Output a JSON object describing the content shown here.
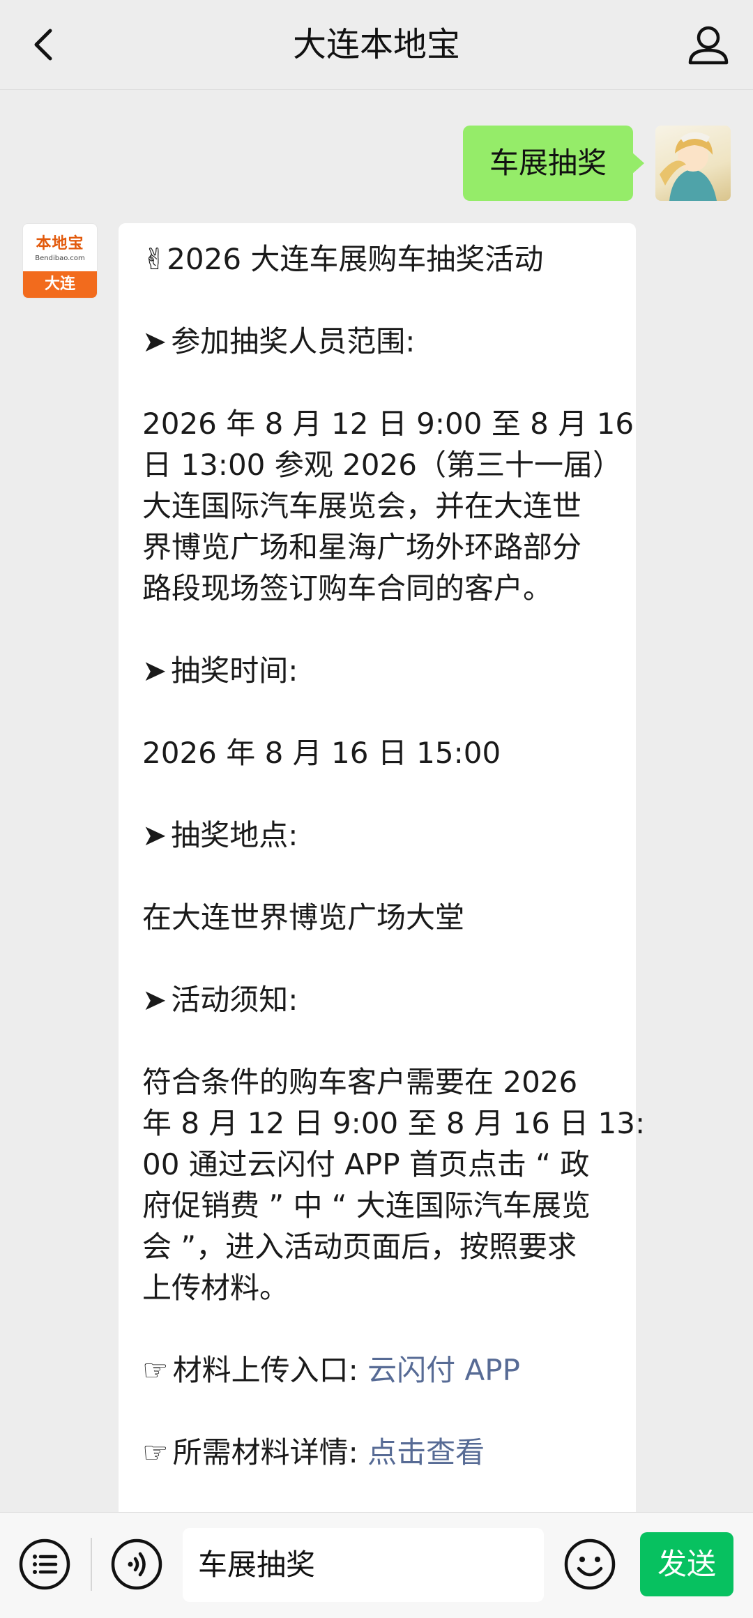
{
  "header": {
    "title": "大连本地宝"
  },
  "chat": {
    "outgoing_message": "车展抽奖",
    "bot": {
      "avatar_text_top": "本地宝",
      "avatar_text_mid": "Bendibao.com",
      "avatar_text_bottom": "大连"
    },
    "reply_lines": [
      {
        "text": "✌2026 大连车展购车抽奖活动"
      },
      {
        "gap": true
      },
      {
        "bullet": "➤",
        "text": "参加抽奖人员范围:"
      },
      {
        "gap": true
      },
      {
        "text": "2026 年 8 月 12 日 9:00 至 8 月 16"
      },
      {
        "text": "日 13:00 参观 2026（第三十一届）"
      },
      {
        "text": "大连国际汽车展览会，并在大连世"
      },
      {
        "text": "界博览广场和星海广场外环路部分"
      },
      {
        "text": "路段现场签订购车合同的客户。"
      },
      {
        "gap": true
      },
      {
        "bullet": "➤",
        "text": "抽奖时间:"
      },
      {
        "gap": true
      },
      {
        "text": "2026 年 8 月 16 日 15:00"
      },
      {
        "gap": true
      },
      {
        "bullet": "➤",
        "text": "抽奖地点:"
      },
      {
        "gap": true
      },
      {
        "text": "在大连世界博览广场大堂"
      },
      {
        "gap": true
      },
      {
        "bullet": "➤",
        "text": "活动须知:"
      },
      {
        "gap": true
      },
      {
        "text": "符合条件的购车客户需要在 2026"
      },
      {
        "text": "年 8 月 12 日 9:00 至 8 月 16 日 13:"
      },
      {
        "text": "00 通过云闪付 APP 首页点击 “ 政"
      },
      {
        "text": "府促销费 ” 中 “ 大连国际汽车展览"
      },
      {
        "text": "会 ”，进入活动页面后，按照要求"
      },
      {
        "text": "上传材料。"
      },
      {
        "gap": true
      },
      {
        "bullet": "☞",
        "text": "材料上传入口: ",
        "link": "云闪付 APP"
      },
      {
        "gap": true
      },
      {
        "bullet": "☞",
        "text": "所需材料详情: ",
        "link": "点击查看"
      }
    ]
  },
  "input_bar": {
    "input_value": "车展抽奖",
    "send_label": "发送"
  },
  "icons": {
    "back": "chevron-left-icon",
    "profile": "person-icon",
    "menu": "list-icon",
    "voice": "voice-icon",
    "emoji": "emoji-icon"
  },
  "colors": {
    "outgoing_bubble": "#95ec69",
    "send_button": "#07c160",
    "link": "#576b95",
    "brand_orange": "#f26b1d"
  }
}
